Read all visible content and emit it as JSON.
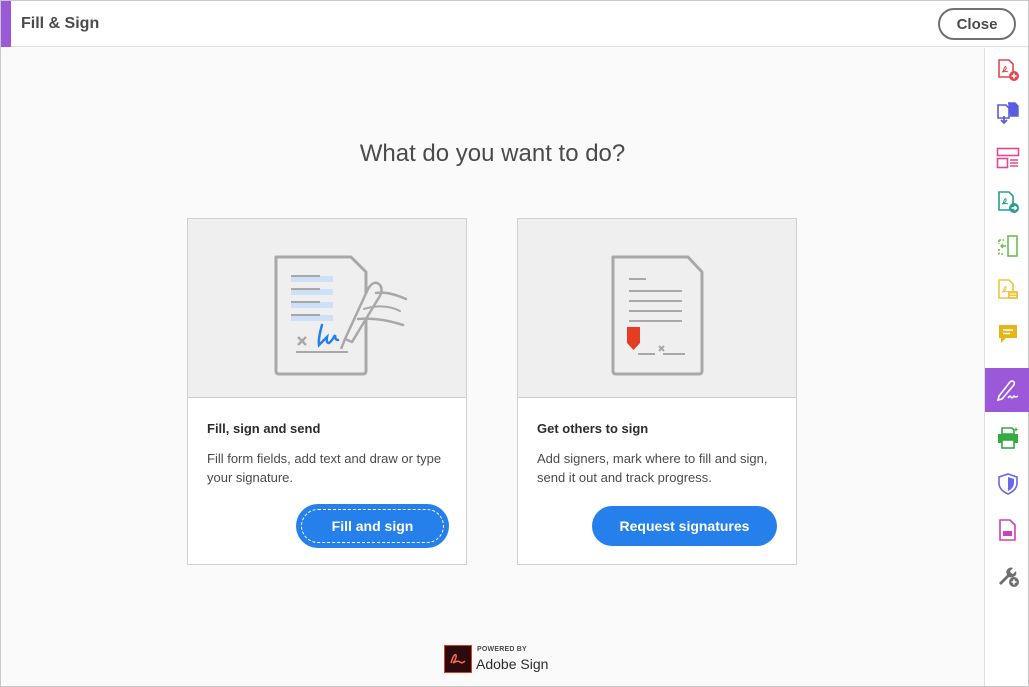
{
  "header": {
    "title": "Fill & Sign",
    "close_label": "Close"
  },
  "main": {
    "heading": "What do you want to do?"
  },
  "cards": [
    {
      "title": "Fill, sign and send",
      "description": "Fill form fields, add text and draw or type your signature.",
      "button_label": "Fill and sign"
    },
    {
      "title": "Get others to sign",
      "description": "Add signers, mark where to fill and sign, send it out and track progress.",
      "button_label": "Request signatures"
    }
  ],
  "footer": {
    "powered_by": "POWERED BY",
    "brand": "Adobe Sign"
  },
  "tool_rail": {
    "items": [
      {
        "icon": "create-pdf-icon",
        "color": "#e34850"
      },
      {
        "icon": "combine-files-icon",
        "color": "#5c5ce0"
      },
      {
        "icon": "organize-pages-icon",
        "color": "#e34890"
      },
      {
        "icon": "export-pdf-icon",
        "color": "#2a9d8f"
      },
      {
        "icon": "edit-pdf-icon",
        "color": "#6cc04a"
      },
      {
        "icon": "prepare-form-icon",
        "color": "#f0c540"
      },
      {
        "icon": "comment-icon",
        "color": "#e8b418"
      },
      {
        "icon": "fill-sign-icon",
        "color": "#ffffff",
        "active": true
      },
      {
        "icon": "print-production-icon",
        "color": "#33ab40"
      },
      {
        "icon": "protect-icon",
        "color": "#6767ec"
      },
      {
        "icon": "pdf-standards-icon",
        "color": "#cf3ebe"
      },
      {
        "icon": "more-tools-icon",
        "color": "#6e6e6e"
      }
    ]
  },
  "colors": {
    "accent": "#9b58d8",
    "primary_button": "#2680eb"
  }
}
